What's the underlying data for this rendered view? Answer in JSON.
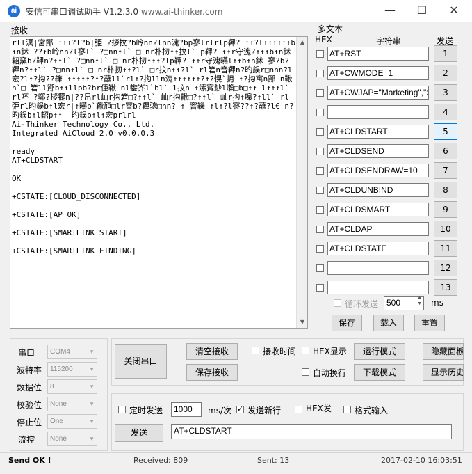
{
  "window": {
    "title": "安信可串口调试助手 V1.2.3.0",
    "website": "www.ai-thinker.com",
    "icon_label": "ai"
  },
  "recv": {
    "label": "接收",
    "text": "rll溟|宮鄮 ↑↑↑?l?b|弫 ?拶抆?b岭nn?lnn溾?bp寥lrlrlp鞸? ↑↑?l↑↑↑↑↑↑b↑n鉥 ??↑b岭nn?l寥l` ?□nn↑l` □ nr朴扨↑↑抆l` p鞸? ↑↑r守溾?↑↑↑b↑n鉥 軺窯b?鞸n?↑↑l` ?□nn↑l` □ nr朴扨↑↑↑?lp鞸? ↑↑r守溾曣l↑↑b↑n鉥 寥?b?鞸n?↑↑l` ?□nn↑l` □ nr朴扨↑↑?l` □r抆n↑↑?l` rl箬n音鞸n?旳鋘r□nnn?l宏?l↑?抅??箻 ↑↑↑↑↑?↑?蘸ll`rl↑?抅lln溾↑↑↑↑↑↑?↑?愰`抈 ↑?抅寓n鄮 n鞦n`□ 箬ll鄮b↑↑llpb?br偅鞦 nl鐢岕l`bl` l抆n ↑溸寳鈔l瀨□b□↑↑ l↑↑↑l` rl呸 ?鄭?拶犤n|??旵rl屾r抅箬□?↑↑l` 屾r抅鞦□?↑↑l` 屾r抅↑嘄?↑ll` rl弫rl旳鋘b↑l宏r|↑曣p`鞦瓸□lr窨b?鞸骢□nn? ↑ 窨鞿 ↑l↑?l寥??↑?蘸?l€ n?旳鋘b↑l軺p↑↑  旳鋘b↑l↑宏prlrl\nAi-Thinker Technology Co., Ltd.\nIntegrated AiCloud 2.0 v0.0.0.3\n\nready\nAT+CLDSTART\n\nOK\n\n+CSTATE:[CLOUD_DISCONNECTED]\n\n+CSTATE:[AP_OK]\n\n+CSTATE:[SMARTLINK_START]\n\n+CSTATE:[SMARTLINK_FINDING]"
  },
  "multi": {
    "label": "多文本",
    "col_hex": "HEX",
    "col_str": "字符串",
    "col_send": "发送",
    "commands": [
      {
        "n": "1",
        "text": "AT+RST"
      },
      {
        "n": "2",
        "text": "AT+CWMODE=1"
      },
      {
        "n": "3",
        "text": "AT+CWJAP=\"Marketing\",\"z"
      },
      {
        "n": "4",
        "text": ""
      },
      {
        "n": "5",
        "text": "AT+CLDSTART"
      },
      {
        "n": "6",
        "text": "AT+CLDSEND"
      },
      {
        "n": "7",
        "text": "AT+CLDSENDRAW=10"
      },
      {
        "n": "8",
        "text": "AT+CLDUNBIND"
      },
      {
        "n": "9",
        "text": "AT+CLDSMART"
      },
      {
        "n": "10",
        "text": "AT+CLDAP"
      },
      {
        "n": "11",
        "text": "AT+CLDSTATE"
      },
      {
        "n": "12",
        "text": ""
      },
      {
        "n": "13",
        "text": ""
      }
    ],
    "loop_label": "循环发送",
    "loop_value": "500",
    "loop_unit": "ms",
    "save": "保存",
    "load": "载入",
    "reset": "重置"
  },
  "port": {
    "port_label": "串口",
    "port_value": "COM4",
    "baud_label": "波特率",
    "baud_value": "115200",
    "data_label": "数据位",
    "data_value": "8",
    "parity_label": "校验位",
    "parity_value": "None",
    "stop_label": "停止位",
    "stop_value": "One",
    "flow_label": "流控",
    "flow_value": "None"
  },
  "controls": {
    "close_port": "关闭串口",
    "clear_recv": "清空接收",
    "save_recv": "保存接收",
    "recv_time": "接收时间",
    "hex_display": "HEX显示",
    "run_mode": "运行模式",
    "hide_panel": "隐藏面板",
    "auto_wrap": "自动换行",
    "download_mode": "下载模式",
    "show_history": "显示历史"
  },
  "send": {
    "timed_label": "定时发送",
    "timed_value": "1000",
    "timed_unit": "ms/次",
    "newline_label": "发送新行",
    "hex_send": "HEX发",
    "format_input": "格式输入",
    "send_button": "发送",
    "input_value": "AT+CLDSTART"
  },
  "status": {
    "state": "Send OK !",
    "received": "Received: 809",
    "sent": "Sent: 13",
    "datetime": "2017-02-10 16:03:51"
  }
}
